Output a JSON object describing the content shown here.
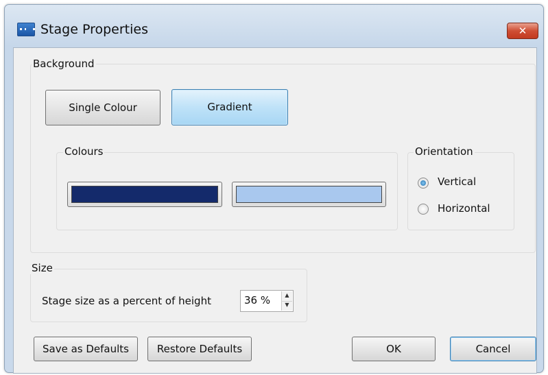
{
  "window": {
    "title": "Stage Properties",
    "close_glyph": "✕"
  },
  "background": {
    "legend": "Background",
    "single_colour_label": "Single Colour",
    "gradient_label": "Gradient",
    "selected_mode": "Gradient",
    "colours": {
      "legend": "Colours",
      "swatches": [
        "#142a6b",
        "#a9c8ee"
      ]
    },
    "orientation": {
      "legend": "Orientation",
      "vertical_label": "Vertical",
      "horizontal_label": "Horizontal",
      "selected": "Vertical"
    }
  },
  "size": {
    "legend": "Size",
    "label": "Stage size as a percent of height",
    "value": "36 %",
    "up_glyph": "▲",
    "down_glyph": "▼"
  },
  "buttons": {
    "save_defaults": "Save as Defaults",
    "restore_defaults": "Restore Defaults",
    "ok": "OK",
    "cancel": "Cancel"
  }
}
